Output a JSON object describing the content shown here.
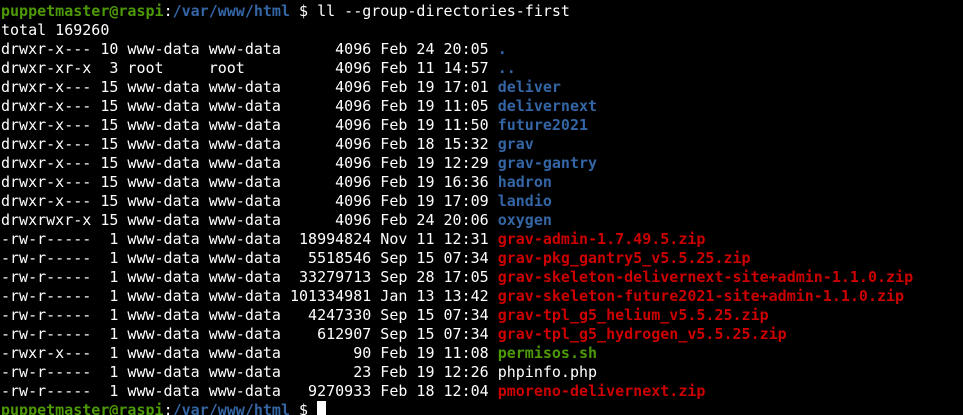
{
  "prompt": {
    "user_host": "puppetmaster@raspi",
    "colon": ":",
    "cwd": "/var/www/html",
    "symbol": " $ "
  },
  "command": "ll --group-directories-first",
  "total_line": "total 169260",
  "entries": [
    {
      "meta": "drwxr-x--- 10 www-data www-data      4096 Feb 24 20:05 ",
      "name": ".",
      "kind": "dir"
    },
    {
      "meta": "drwxr-xr-x  3 root     root          4096 Feb 11 14:57 ",
      "name": "..",
      "kind": "dir"
    },
    {
      "meta": "drwxr-x--- 15 www-data www-data      4096 Feb 19 17:01 ",
      "name": "deliver",
      "kind": "dir"
    },
    {
      "meta": "drwxr-x--- 15 www-data www-data      4096 Feb 19 11:05 ",
      "name": "delivernext",
      "kind": "dir"
    },
    {
      "meta": "drwxr-x--- 15 www-data www-data      4096 Feb 19 11:50 ",
      "name": "future2021",
      "kind": "dir"
    },
    {
      "meta": "drwxr-x--- 15 www-data www-data      4096 Feb 18 15:32 ",
      "name": "grav",
      "kind": "dir"
    },
    {
      "meta": "drwxr-x--- 15 www-data www-data      4096 Feb 19 12:29 ",
      "name": "grav-gantry",
      "kind": "dir"
    },
    {
      "meta": "drwxr-x--- 15 www-data www-data      4096 Feb 19 16:36 ",
      "name": "hadron",
      "kind": "dir"
    },
    {
      "meta": "drwxr-x--- 15 www-data www-data      4096 Feb 19 17:09 ",
      "name": "landio",
      "kind": "dir"
    },
    {
      "meta": "drwxrwxr-x 15 www-data www-data      4096 Feb 24 20:06 ",
      "name": "oxygen",
      "kind": "dir"
    },
    {
      "meta": "-rw-r-----  1 www-data www-data  18994824 Nov 11 12:31 ",
      "name": "grav-admin-1.7.49.5.zip",
      "kind": "arch"
    },
    {
      "meta": "-rw-r-----  1 www-data www-data   5518546 Sep 15 07:34 ",
      "name": "grav-pkg_gantry5_v5.5.25.zip",
      "kind": "arch"
    },
    {
      "meta": "-rw-r-----  1 www-data www-data  33279713 Sep 28 17:05 ",
      "name": "grav-skeleton-delivernext-site+admin-1.1.0.zip",
      "kind": "arch"
    },
    {
      "meta": "-rw-r-----  1 www-data www-data 101334981 Jan 13 13:42 ",
      "name": "grav-skeleton-future2021-site+admin-1.1.0.zip",
      "kind": "arch"
    },
    {
      "meta": "-rw-r-----  1 www-data www-data   4247330 Sep 15 07:34 ",
      "name": "grav-tpl_g5_helium_v5.5.25.zip",
      "kind": "arch"
    },
    {
      "meta": "-rw-r-----  1 www-data www-data    612907 Sep 15 07:34 ",
      "name": "grav-tpl_g5_hydrogen_v5.5.25.zip",
      "kind": "arch"
    },
    {
      "meta": "-rwxr-x---  1 www-data www-data        90 Feb 19 11:08 ",
      "name": "permisos.sh",
      "kind": "exec"
    },
    {
      "meta": "-rw-r-----  1 www-data www-data        23 Feb 19 12:26 ",
      "name": "phpinfo.php",
      "kind": "plain"
    },
    {
      "meta": "-rw-r-----  1 www-data www-data   9270933 Feb 18 12:04 ",
      "name": "pmoreno-delivernext.zip",
      "kind": "arch"
    }
  ],
  "colors": {
    "background": "#000000",
    "foreground": "#ffffff",
    "prompt_user": "#4e9a06",
    "prompt_path": "#3465a4",
    "directory": "#3465a4",
    "archive": "#cc0000",
    "executable": "#4e9a06"
  }
}
